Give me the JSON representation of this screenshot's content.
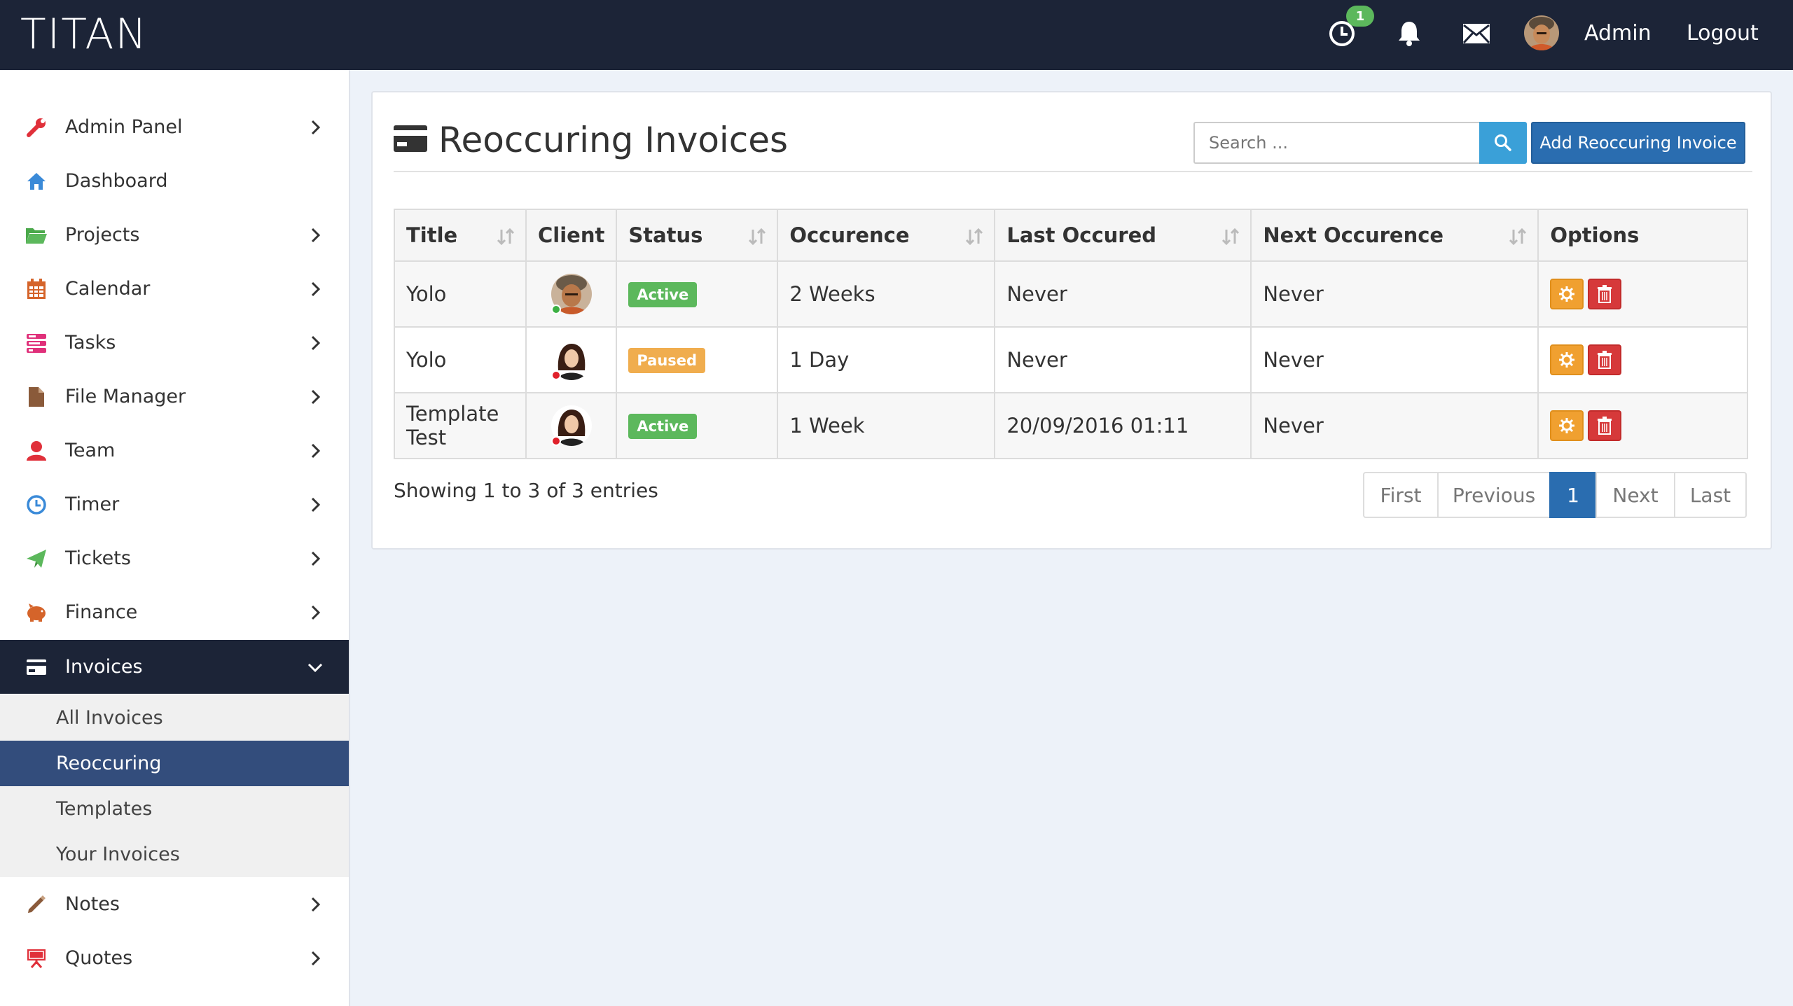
{
  "app": {
    "brand": "TITAN"
  },
  "topbar": {
    "timer_badge": "1",
    "user_name": "Admin",
    "logout_label": "Logout",
    "icons": [
      "clock-icon",
      "bell-icon",
      "envelope-icon",
      "user-avatar"
    ]
  },
  "sidebar": {
    "items": [
      {
        "label": "Admin Panel",
        "icon": "wrench-icon",
        "color": "#e0303a",
        "chevron": "right"
      },
      {
        "label": "Dashboard",
        "icon": "home-icon",
        "color": "#3a8ad8",
        "chevron": ""
      },
      {
        "label": "Projects",
        "icon": "folder-icon",
        "color": "#5cb85c",
        "chevron": "right"
      },
      {
        "label": "Calendar",
        "icon": "calendar-icon",
        "color": "#d5642a",
        "chevron": "right"
      },
      {
        "label": "Tasks",
        "icon": "tasks-icon",
        "color": "#e0307a",
        "chevron": "right"
      },
      {
        "label": "File Manager",
        "icon": "file-icon",
        "color": "#8a5a3a",
        "chevron": "right"
      },
      {
        "label": "Team",
        "icon": "user-icon",
        "color": "#e0303a",
        "chevron": "right"
      },
      {
        "label": "Timer",
        "icon": "clock-icon",
        "color": "#3a8ad8",
        "chevron": "right"
      },
      {
        "label": "Tickets",
        "icon": "paper-plane-icon",
        "color": "#5cb85c",
        "chevron": "right"
      },
      {
        "label": "Finance",
        "icon": "piggy-bank-icon",
        "color": "#d5642a",
        "chevron": "right"
      },
      {
        "label": "Invoices",
        "icon": "credit-card-icon",
        "color": "#ffffff",
        "chevron": "down"
      },
      {
        "label": "Notes",
        "icon": "pencil-icon",
        "color": "#8a5a3a",
        "chevron": "right"
      },
      {
        "label": "Quotes",
        "icon": "easel-icon",
        "color": "#e0303a",
        "chevron": "right"
      }
    ],
    "invoice_sub": [
      {
        "label": "All Invoices"
      },
      {
        "label": "Reoccuring"
      },
      {
        "label": "Templates"
      },
      {
        "label": "Your Invoices"
      }
    ]
  },
  "page": {
    "title": "Reoccuring Invoices",
    "search_placeholder": "Search ...",
    "add_button": "Add Reoccuring Invoice"
  },
  "table": {
    "headers": [
      "Title",
      "Client",
      "Status",
      "Occurence",
      "Last Occured",
      "Next Occurence",
      "Options"
    ],
    "rows": [
      {
        "title": "Yolo",
        "client": "male-avatar",
        "client_status_color": "#3cb043",
        "status": "Active",
        "status_color": "#5cb85c",
        "occurence": "2 Weeks",
        "last": "Never",
        "next": "Never"
      },
      {
        "title": "Yolo",
        "client": "female-avatar",
        "client_status_color": "#e0202a",
        "status": "Paused",
        "status_color": "#f0ad4e",
        "occurence": "1 Day",
        "last": "Never",
        "next": "Never"
      },
      {
        "title": "Template Test",
        "client": "female-avatar",
        "client_status_color": "#e0202a",
        "status": "Active",
        "status_color": "#5cb85c",
        "occurence": "1 Week",
        "last": "20/09/2016 01:11",
        "next": "Never"
      }
    ]
  },
  "footer": {
    "showing": "Showing 1 to 3 of 3 entries",
    "pager": [
      "First",
      "Previous",
      "1",
      "Next",
      "Last"
    ],
    "current_page": "1"
  }
}
